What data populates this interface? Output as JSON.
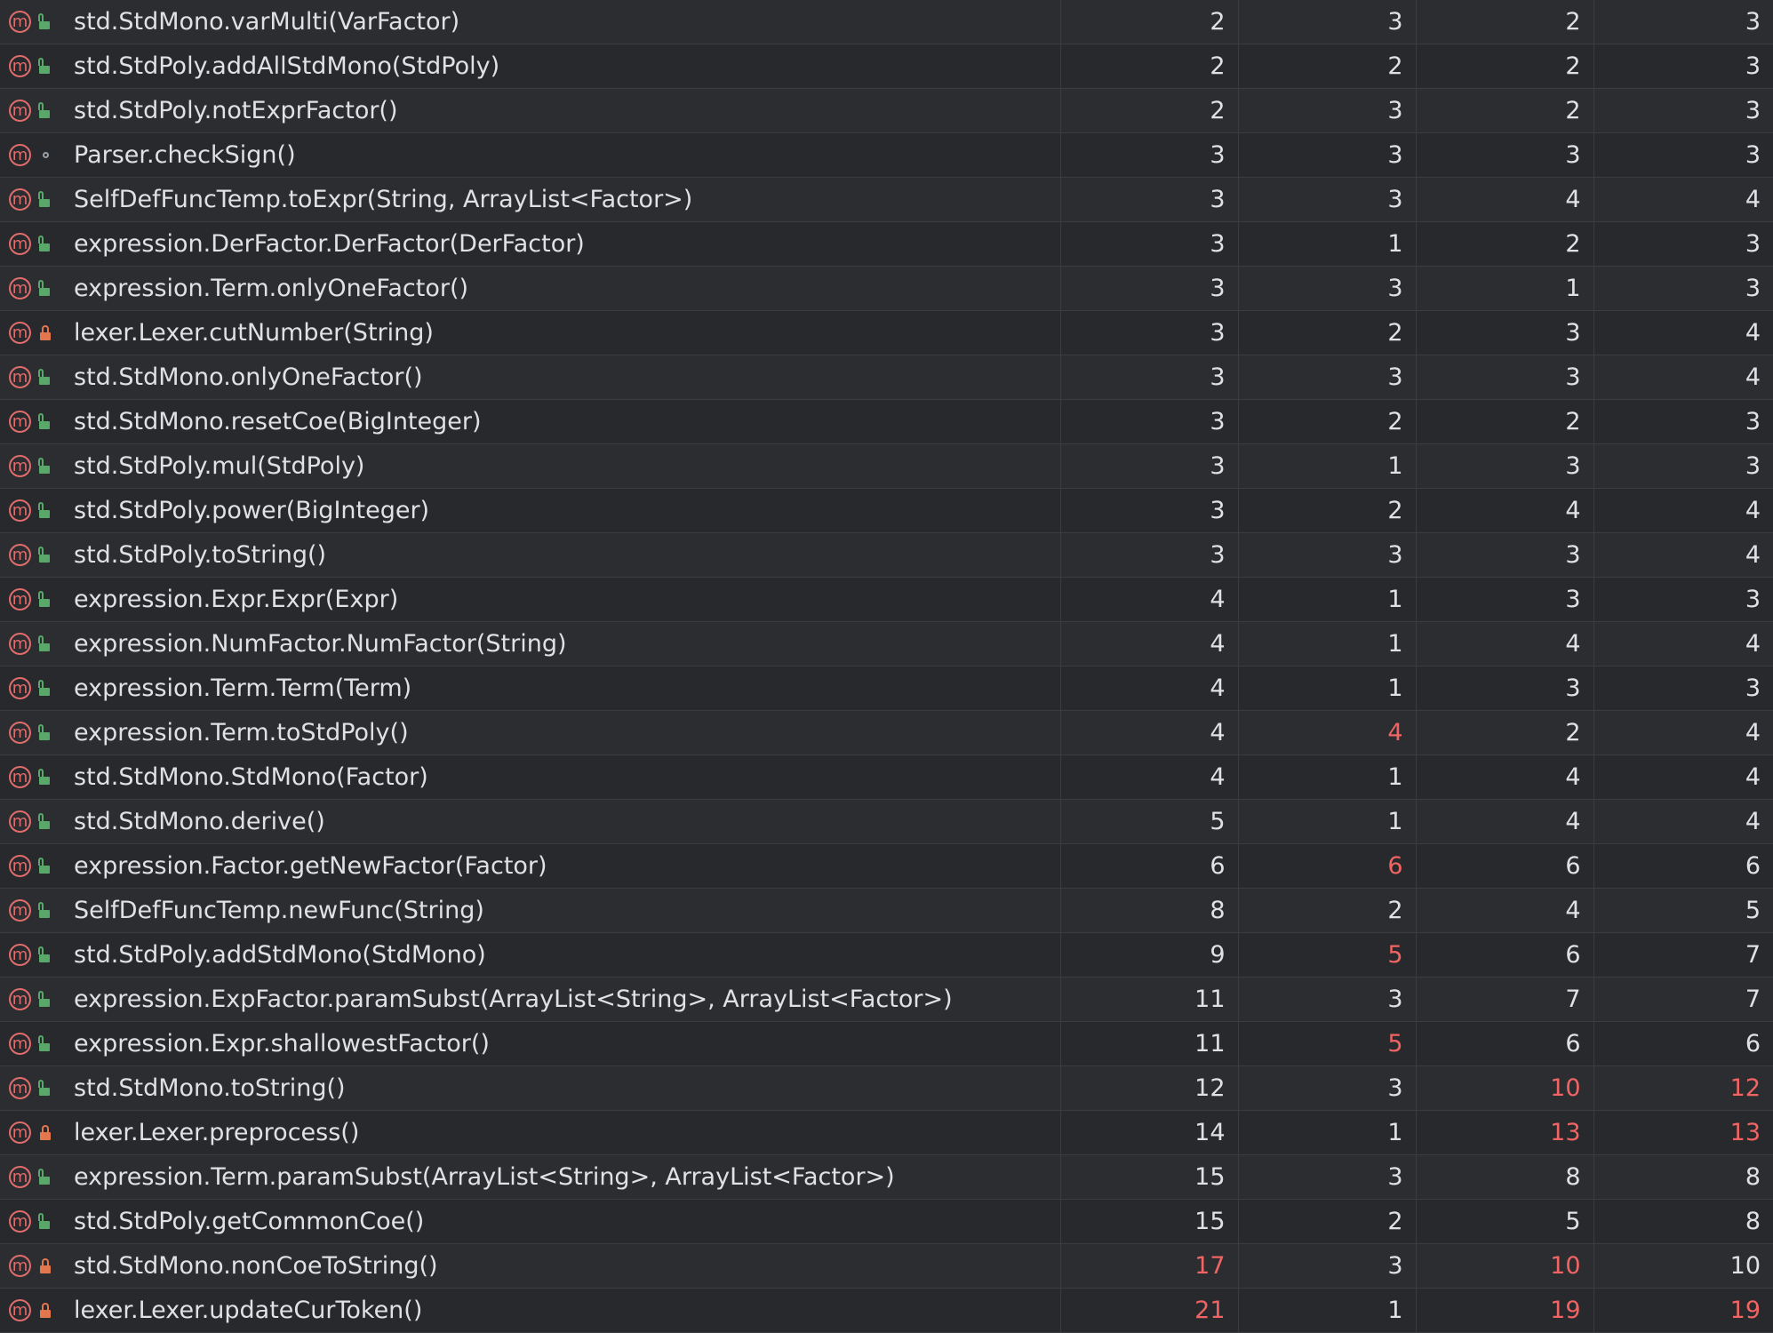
{
  "colors": {
    "background": "#2b2d30",
    "row_alt": "#27292c",
    "text": "#dfe1e5",
    "highlight": "#f06464",
    "method_icon": "#e06c6c",
    "public_icon": "#59a869",
    "private_icon": "#e2774d"
  },
  "icons": {
    "method": "method-icon",
    "public": "public-lock-open-icon",
    "private": "private-lock-icon",
    "package": "package-private-circle-icon"
  },
  "method_icon_letter": "m",
  "rows": [
    {
      "method": "std.StdMono.varMulti(VarFactor)",
      "visibility": "public",
      "values": [
        "2",
        "3",
        "2",
        "3"
      ],
      "highlight": [
        false,
        false,
        false,
        false
      ]
    },
    {
      "method": "std.StdPoly.addAllStdMono(StdPoly)",
      "visibility": "public",
      "values": [
        "2",
        "2",
        "2",
        "3"
      ],
      "highlight": [
        false,
        false,
        false,
        false
      ]
    },
    {
      "method": "std.StdPoly.notExprFactor()",
      "visibility": "public",
      "values": [
        "2",
        "3",
        "2",
        "3"
      ],
      "highlight": [
        false,
        false,
        false,
        false
      ]
    },
    {
      "method": "Parser.checkSign()",
      "visibility": "package",
      "values": [
        "3",
        "3",
        "3",
        "3"
      ],
      "highlight": [
        false,
        false,
        false,
        false
      ]
    },
    {
      "method": "SelfDefFuncTemp.toExpr(String, ArrayList<Factor>)",
      "visibility": "public",
      "values": [
        "3",
        "3",
        "4",
        "4"
      ],
      "highlight": [
        false,
        false,
        false,
        false
      ]
    },
    {
      "method": "expression.DerFactor.DerFactor(DerFactor)",
      "visibility": "public",
      "values": [
        "3",
        "1",
        "2",
        "3"
      ],
      "highlight": [
        false,
        false,
        false,
        false
      ]
    },
    {
      "method": "expression.Term.onlyOneFactor()",
      "visibility": "public",
      "values": [
        "3",
        "3",
        "1",
        "3"
      ],
      "highlight": [
        false,
        false,
        false,
        false
      ]
    },
    {
      "method": "lexer.Lexer.cutNumber(String)",
      "visibility": "private",
      "values": [
        "3",
        "2",
        "3",
        "4"
      ],
      "highlight": [
        false,
        false,
        false,
        false
      ]
    },
    {
      "method": "std.StdMono.onlyOneFactor()",
      "visibility": "public",
      "values": [
        "3",
        "3",
        "3",
        "4"
      ],
      "highlight": [
        false,
        false,
        false,
        false
      ]
    },
    {
      "method": "std.StdMono.resetCoe(BigInteger)",
      "visibility": "public",
      "values": [
        "3",
        "2",
        "2",
        "3"
      ],
      "highlight": [
        false,
        false,
        false,
        false
      ]
    },
    {
      "method": "std.StdPoly.mul(StdPoly)",
      "visibility": "public",
      "values": [
        "3",
        "1",
        "3",
        "3"
      ],
      "highlight": [
        false,
        false,
        false,
        false
      ]
    },
    {
      "method": "std.StdPoly.power(BigInteger)",
      "visibility": "public",
      "values": [
        "3",
        "2",
        "4",
        "4"
      ],
      "highlight": [
        false,
        false,
        false,
        false
      ]
    },
    {
      "method": "std.StdPoly.toString()",
      "visibility": "public",
      "values": [
        "3",
        "3",
        "3",
        "4"
      ],
      "highlight": [
        false,
        false,
        false,
        false
      ]
    },
    {
      "method": "expression.Expr.Expr(Expr)",
      "visibility": "public",
      "values": [
        "4",
        "1",
        "3",
        "3"
      ],
      "highlight": [
        false,
        false,
        false,
        false
      ]
    },
    {
      "method": "expression.NumFactor.NumFactor(String)",
      "visibility": "public",
      "values": [
        "4",
        "1",
        "4",
        "4"
      ],
      "highlight": [
        false,
        false,
        false,
        false
      ]
    },
    {
      "method": "expression.Term.Term(Term)",
      "visibility": "public",
      "values": [
        "4",
        "1",
        "3",
        "3"
      ],
      "highlight": [
        false,
        false,
        false,
        false
      ]
    },
    {
      "method": "expression.Term.toStdPoly()",
      "visibility": "public",
      "values": [
        "4",
        "4",
        "2",
        "4"
      ],
      "highlight": [
        false,
        true,
        false,
        false
      ]
    },
    {
      "method": "std.StdMono.StdMono(Factor)",
      "visibility": "public",
      "values": [
        "4",
        "1",
        "4",
        "4"
      ],
      "highlight": [
        false,
        false,
        false,
        false
      ]
    },
    {
      "method": "std.StdMono.derive()",
      "visibility": "public",
      "values": [
        "5",
        "1",
        "4",
        "4"
      ],
      "highlight": [
        false,
        false,
        false,
        false
      ]
    },
    {
      "method": "expression.Factor.getNewFactor(Factor)",
      "visibility": "public",
      "values": [
        "6",
        "6",
        "6",
        "6"
      ],
      "highlight": [
        false,
        true,
        false,
        false
      ]
    },
    {
      "method": "SelfDefFuncTemp.newFunc(String)",
      "visibility": "public",
      "values": [
        "8",
        "2",
        "4",
        "5"
      ],
      "highlight": [
        false,
        false,
        false,
        false
      ]
    },
    {
      "method": "std.StdPoly.addStdMono(StdMono)",
      "visibility": "public",
      "values": [
        "9",
        "5",
        "6",
        "7"
      ],
      "highlight": [
        false,
        true,
        false,
        false
      ]
    },
    {
      "method": "expression.ExpFactor.paramSubst(ArrayList<String>, ArrayList<Factor>)",
      "visibility": "public",
      "values": [
        "11",
        "3",
        "7",
        "7"
      ],
      "highlight": [
        false,
        false,
        false,
        false
      ]
    },
    {
      "method": "expression.Expr.shallowestFactor()",
      "visibility": "public",
      "values": [
        "11",
        "5",
        "6",
        "6"
      ],
      "highlight": [
        false,
        true,
        false,
        false
      ]
    },
    {
      "method": "std.StdMono.toString()",
      "visibility": "public",
      "values": [
        "12",
        "3",
        "10",
        "12"
      ],
      "highlight": [
        false,
        false,
        true,
        true
      ]
    },
    {
      "method": "lexer.Lexer.preprocess()",
      "visibility": "private",
      "values": [
        "14",
        "1",
        "13",
        "13"
      ],
      "highlight": [
        false,
        false,
        true,
        true
      ]
    },
    {
      "method": "expression.Term.paramSubst(ArrayList<String>, ArrayList<Factor>)",
      "visibility": "public",
      "values": [
        "15",
        "3",
        "8",
        "8"
      ],
      "highlight": [
        false,
        false,
        false,
        false
      ]
    },
    {
      "method": "std.StdPoly.getCommonCoe()",
      "visibility": "public",
      "values": [
        "15",
        "2",
        "5",
        "8"
      ],
      "highlight": [
        false,
        false,
        false,
        false
      ]
    },
    {
      "method": "std.StdMono.nonCoeToString()",
      "visibility": "private",
      "values": [
        "17",
        "3",
        "10",
        "10"
      ],
      "highlight": [
        true,
        false,
        true,
        false
      ]
    },
    {
      "method": "lexer.Lexer.updateCurToken()",
      "visibility": "private",
      "values": [
        "21",
        "1",
        "19",
        "19"
      ],
      "highlight": [
        true,
        false,
        true,
        true
      ]
    }
  ]
}
